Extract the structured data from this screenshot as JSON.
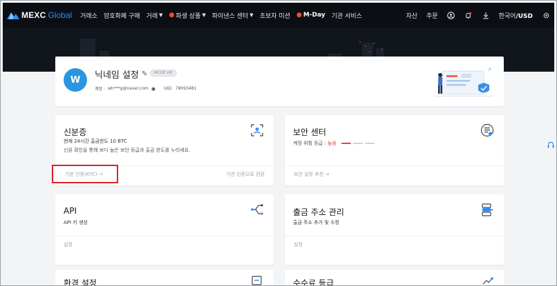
{
  "nav": {
    "logo_text": "MEXC",
    "logo_text2": "Global",
    "items": [
      {
        "label": "거래소",
        "dropdown": false,
        "hot": false
      },
      {
        "label": "암호화폐 구매",
        "dropdown": false,
        "hot": false
      },
      {
        "label": "거래",
        "dropdown": true,
        "hot": false
      },
      {
        "label": "파생 상품",
        "dropdown": true,
        "hot": true
      },
      {
        "label": "파이낸스 센터",
        "dropdown": true,
        "hot": false
      },
      {
        "label": "초보자 미션",
        "dropdown": false,
        "hot": false
      },
      {
        "label": "M-Day",
        "dropdown": false,
        "hot": true
      },
      {
        "label": "기관 서비스",
        "dropdown": false,
        "hot": false
      }
    ],
    "right": {
      "assets": "자산",
      "orders": "주문",
      "lang": "한국어",
      "currency": "/USD"
    }
  },
  "profile": {
    "avatar_letter": "W",
    "nickname": "닉네임 설정",
    "vip": "MCUE VIP",
    "account_label": "계정 :",
    "account": "wh***g@naver.com",
    "uid_label": "UID:",
    "uid": "78093481"
  },
  "cards": {
    "id": {
      "title": "신분증",
      "line1": "현재 24시간 출금한도 10 BTC",
      "line2": "신원 확인을 통해 보다 높은 보안 등급과 출금 한도를 누리세요.",
      "foot_left": "기본 인증(KYC) →",
      "foot_right": "기관 인증으로 전환"
    },
    "security": {
      "title": "보안 센터",
      "risk_label": "계정 위험 등급 :",
      "risk_value": "높음",
      "foot_left": "보안 설정 추천 →"
    },
    "api": {
      "title": "API",
      "line1": "API 키 생성",
      "foot_left": "설정"
    },
    "withdraw": {
      "title": "출금 주소 관리",
      "line1": "출금 주소 추가 및 수정",
      "foot_left": "설정"
    },
    "prefs": {
      "title": "환경 설정"
    },
    "fees": {
      "title": "수수료 등급"
    }
  },
  "colors": {
    "nav_bg": "#0b0e13",
    "accent": "#2f8cff",
    "danger": "#e5453c",
    "highlight_box": "#d8222a",
    "page_bg": "#f3f4f6"
  }
}
